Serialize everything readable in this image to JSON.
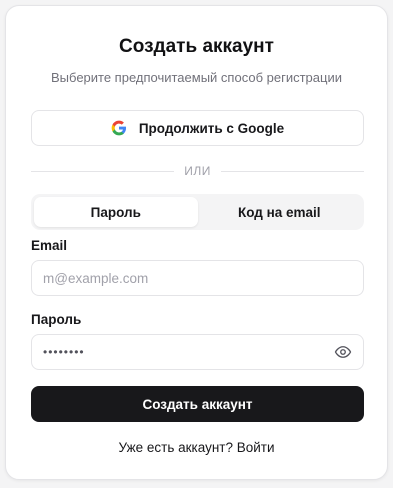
{
  "card": {
    "title": "Создать аккаунт",
    "subtitle": "Выберите предпочитаемый способ регистрации"
  },
  "google": {
    "label": "Продолжить с Google",
    "icon": "google-icon"
  },
  "divider": {
    "text": "ИЛИ"
  },
  "tabs": [
    {
      "label": "Пароль",
      "active": true
    },
    {
      "label": "Код на email",
      "active": false
    }
  ],
  "email": {
    "label": "Email",
    "placeholder": "m@example.com",
    "value": ""
  },
  "password": {
    "label": "Пароль",
    "masked_value": "••••••••",
    "toggle_icon": "eye-icon"
  },
  "submit": {
    "label": "Создать аккаунт"
  },
  "footer": {
    "prompt": "Уже есть аккаунт?",
    "link": "Войти"
  },
  "colors": {
    "primary": "#18181b",
    "muted": "#71717a",
    "border": "#e4e4e7",
    "background": "#f4f4f5"
  }
}
